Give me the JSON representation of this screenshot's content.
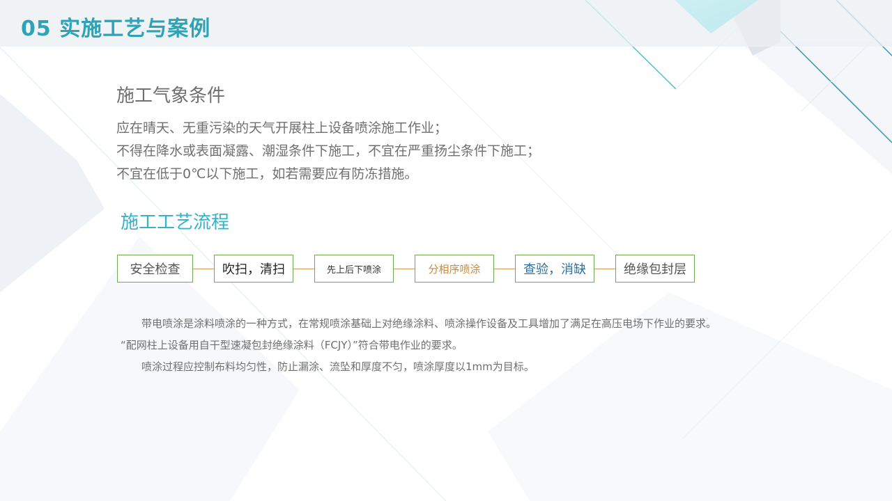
{
  "header": {
    "title": "05 实施工艺与案例"
  },
  "weather": {
    "heading": "施工气象条件",
    "lines": [
      "应在晴天、无重污染的天气开展柱上设备喷涂施工作业；",
      "不得在降水或表面凝露、潮湿条件下施工，不宜在严重扬尘条件下施工；",
      "不宜在低于0℃以下施工，如若需要应有防冻措施。"
    ]
  },
  "process": {
    "heading": "施工工艺流程",
    "steps": [
      {
        "label": "安全检查",
        "color": "#555555"
      },
      {
        "label": "吹扫，清扫",
        "color": "#222222"
      },
      {
        "label": "先上后下喷涂",
        "color": "#333333"
      },
      {
        "label": "分相序喷涂",
        "color": "#c98a3c"
      },
      {
        "label": "查验，消缺",
        "color": "#2e6fa0"
      },
      {
        "label": "绝缘包封层",
        "color": "#555555"
      }
    ]
  },
  "description": {
    "paragraphs": [
      "带电喷涂是涂料喷涂的一种方式，在常规喷涂基础上对绝缘涂料、喷涂操作设备及工具增加了满足在高压电场下作业的要求。",
      "“配网柱上设备用自干型速凝包封绝缘涂料（FCJY）”符合带电作业的要求。",
      "喷涂过程应控制布料均匀性，防止漏涂、流坠和厚度不匀，喷涂厚度以1mm为目标。"
    ]
  },
  "colors": {
    "title": "#2fa3b6",
    "flow_heading": "#35b2c8",
    "step_border": "#72a84f",
    "connector": "#d4935a",
    "body_text": "#6f6f6f",
    "accent_cyan": "#3ee0e8"
  }
}
